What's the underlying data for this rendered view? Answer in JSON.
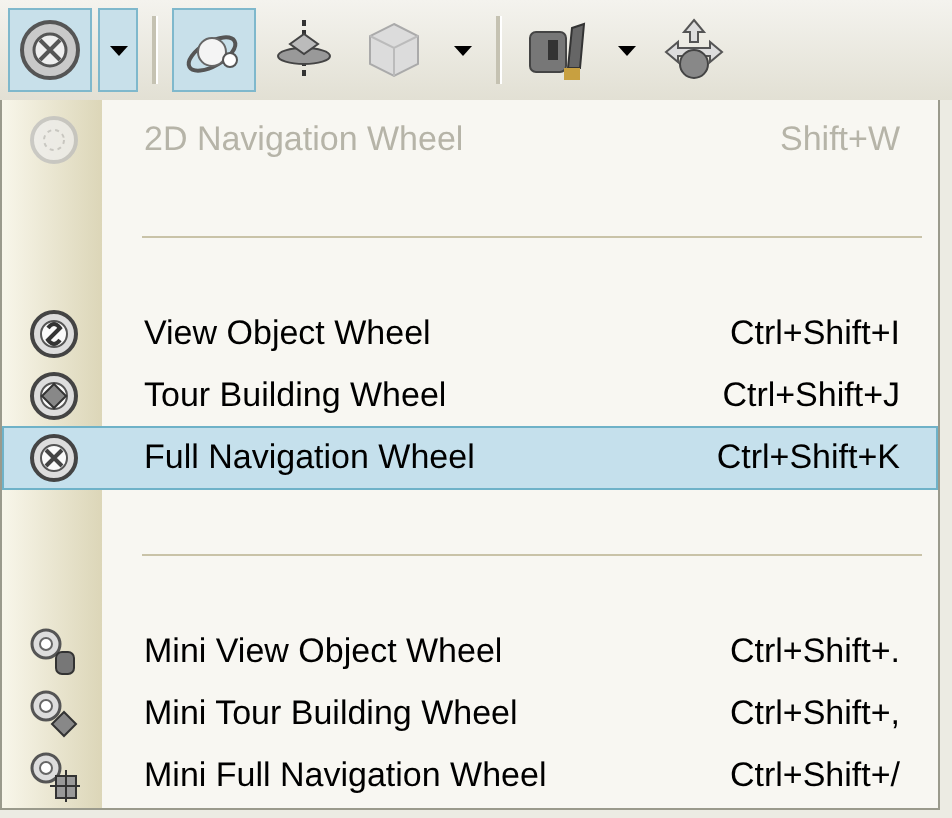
{
  "toolbar": [
    {
      "kind": "button",
      "selected": true
    },
    {
      "kind": "dropdown",
      "selected": true
    },
    {
      "kind": "separator"
    },
    {
      "kind": "button",
      "selected": true
    },
    {
      "kind": "button",
      "selected": false
    },
    {
      "kind": "button",
      "selected": false
    },
    {
      "kind": "dropdown",
      "selected": false
    },
    {
      "kind": "separator"
    },
    {
      "kind": "button",
      "selected": false
    },
    {
      "kind": "dropdown",
      "selected": false
    },
    {
      "kind": "button",
      "selected": false
    }
  ],
  "menu": [
    {
      "kind": "item",
      "label": "2D Navigation Wheel",
      "shortcut": "Shift+W",
      "disabled": true,
      "selected": false
    },
    {
      "kind": "separator"
    },
    {
      "kind": "item",
      "label": "View Object Wheel",
      "shortcut": "Ctrl+Shift+I",
      "disabled": false,
      "selected": false
    },
    {
      "kind": "item",
      "label": "Tour Building Wheel",
      "shortcut": "Ctrl+Shift+J",
      "disabled": false,
      "selected": false
    },
    {
      "kind": "item",
      "label": "Full Navigation Wheel",
      "shortcut": "Ctrl+Shift+K",
      "disabled": false,
      "selected": true
    },
    {
      "kind": "separator"
    },
    {
      "kind": "item",
      "label": "Mini View Object Wheel",
      "shortcut": "Ctrl+Shift+.",
      "disabled": false,
      "selected": false
    },
    {
      "kind": "item",
      "label": "Mini Tour Building Wheel",
      "shortcut": "Ctrl+Shift+,",
      "disabled": false,
      "selected": false
    },
    {
      "kind": "item",
      "label": "Mini Full Navigation Wheel",
      "shortcut": "Ctrl+Shift+/",
      "disabled": false,
      "selected": false
    }
  ]
}
